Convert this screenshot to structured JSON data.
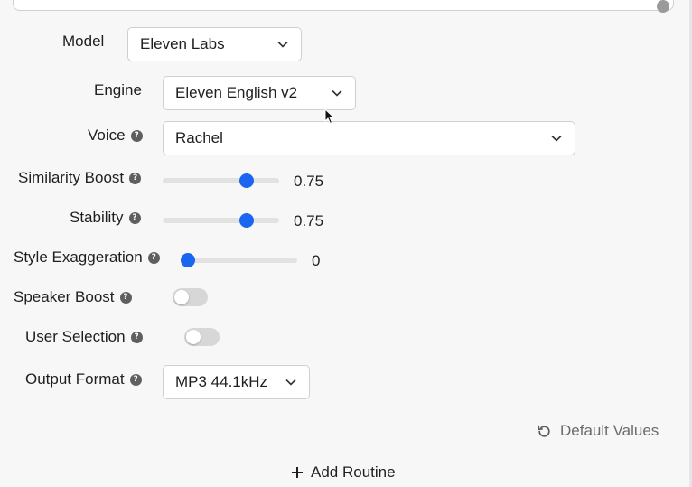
{
  "fields": {
    "model": {
      "label": "Model",
      "value": "Eleven Labs"
    },
    "engine": {
      "label": "Engine",
      "value": "Eleven English v2"
    },
    "voice": {
      "label": "Voice",
      "value": "Rachel"
    },
    "similarity_boost": {
      "label": "Similarity Boost",
      "value": "0.75",
      "fraction": 0.75
    },
    "stability": {
      "label": "Stability",
      "value": "0.75",
      "fraction": 0.75
    },
    "style_exaggeration": {
      "label": "Style Exaggeration",
      "value": "0",
      "fraction": 0
    },
    "speaker_boost": {
      "label": "Speaker Boost",
      "on": false
    },
    "user_selection": {
      "label": "User Selection",
      "on": false
    },
    "output_format": {
      "label": "Output Format",
      "value": "MP3 44.1kHz"
    }
  },
  "help_glyph": "?",
  "actions": {
    "default_values": "Default Values",
    "add_routine": "Add Routine"
  },
  "icons": {
    "dropdown": "chevron-down-icon",
    "help": "help-icon",
    "reset": "reset-icon",
    "add": "plus-icon"
  },
  "colors": {
    "accent": "#1a66f0",
    "toggle_off": "#d7d7d7",
    "background": "#f7f7f7"
  }
}
